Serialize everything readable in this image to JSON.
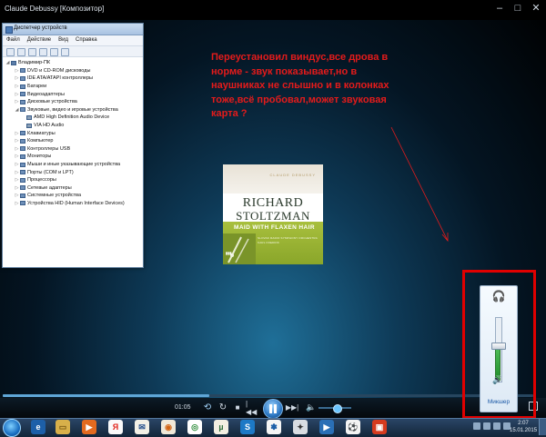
{
  "wmp": {
    "window_title": "Claude Debussy [Композитор]",
    "annotation": "Переустановил виндус,все дрова в норме - звук показывает,но в наушниках не слышно и в колонках тоже,всё пробовал,может звуковая карта ?",
    "album": {
      "brand": "CLAUDE DEBUSSY",
      "artist_line1": "RICHARD",
      "artist_line2": "STOLTZMAN",
      "album_title": "MAID WITH FLAXEN HAIR",
      "small_line1": "SLOVAK RADIO SYMPHONY ORCHESTRA",
      "small_line2": "KARL FREDRIK"
    },
    "time_elapsed": "01:05",
    "seek_progress": 0.39,
    "volume_level": 0.55
  },
  "device_manager": {
    "title": "Диспетчер устройств",
    "menu": [
      "Файл",
      "Действие",
      "Вид",
      "Справка"
    ],
    "root": "Владимир-ПК",
    "items": [
      "DVD и CD-ROM дисководы",
      "IDE ATA/ATAPI контроллеры",
      "Батареи",
      "Видеоадаптеры",
      "Дисковые устройства",
      "Звуковые, видео и игровые устройства",
      "AMD High Definition Audio Device",
      "VIA HD Audio",
      "Клавиатуры",
      "Компьютер",
      "Контроллеры USB",
      "Мониторы",
      "Мыши и иные указывающие устройства",
      "Порты (COM и LPT)",
      "Процессоры",
      "Сетевые адаптеры",
      "Системные устройства",
      "Устройства HID (Human Interface Devices)"
    ]
  },
  "volume_flyout": {
    "level": 0.55,
    "mixer_label": "Микшер"
  },
  "taskbar": {
    "clock_time": "2:07",
    "clock_date": "15.01.2015"
  },
  "colors": {
    "annotation": "#e41b1b",
    "highlight_box": "#e00000"
  }
}
